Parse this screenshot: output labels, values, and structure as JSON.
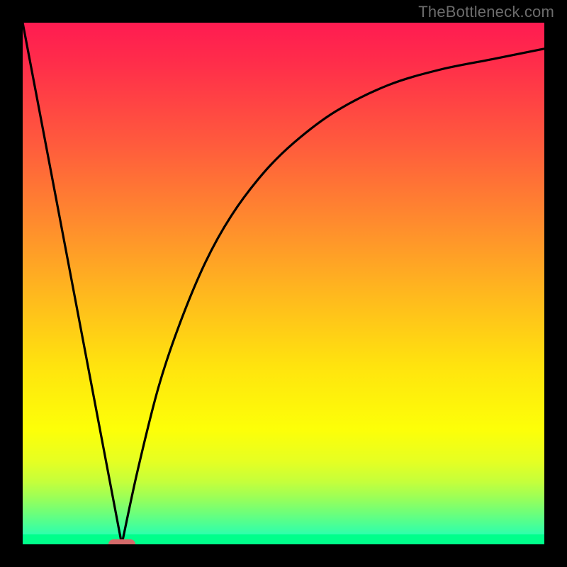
{
  "watermark": "TheBottleneck.com",
  "chart_data": {
    "type": "line",
    "title": "",
    "xlabel": "",
    "ylabel": "",
    "xlim": [
      0,
      100
    ],
    "ylim": [
      0,
      100
    ],
    "grid": false,
    "legend": false,
    "series": [
      {
        "name": "left-line",
        "x": [
          0,
          19
        ],
        "y": [
          100,
          0
        ]
      },
      {
        "name": "right-curve",
        "x": [
          19,
          22,
          26,
          30,
          35,
          40,
          46,
          52,
          60,
          70,
          80,
          90,
          100
        ],
        "y": [
          0,
          14,
          30,
          42,
          54,
          63,
          71,
          77,
          83,
          88,
          91,
          93,
          95
        ]
      }
    ],
    "marker": {
      "x": 19,
      "y": 0,
      "shape": "rounded-pill",
      "color": "#d46a6a"
    },
    "background_gradient": {
      "top": "#ff1b51",
      "bottom": "#16ffc3"
    }
  }
}
